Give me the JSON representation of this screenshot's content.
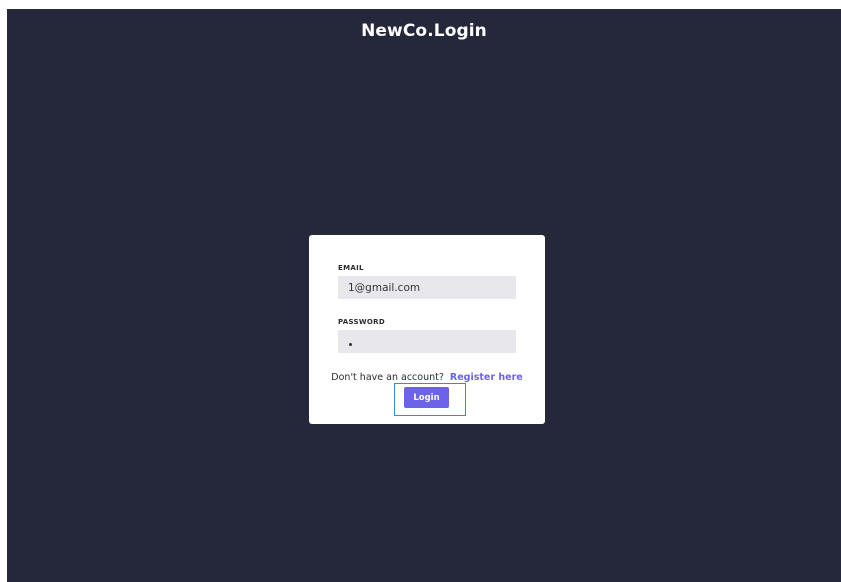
{
  "app": {
    "title": "NewCo.Login"
  },
  "login_form": {
    "email": {
      "label": "EMAIL",
      "value": "1@gmail.com"
    },
    "password": {
      "label": "PASSWORD",
      "value": "•",
      "masked_length": 1
    },
    "register_prompt": "Don't have an account?",
    "register_link": "Register here",
    "submit_label": "Login"
  },
  "colors": {
    "background": "#25273a",
    "card": "#ffffff",
    "input_background": "#e8e7ec",
    "accent": "#6c63e8",
    "focus_outline": "#2f8bf0"
  }
}
